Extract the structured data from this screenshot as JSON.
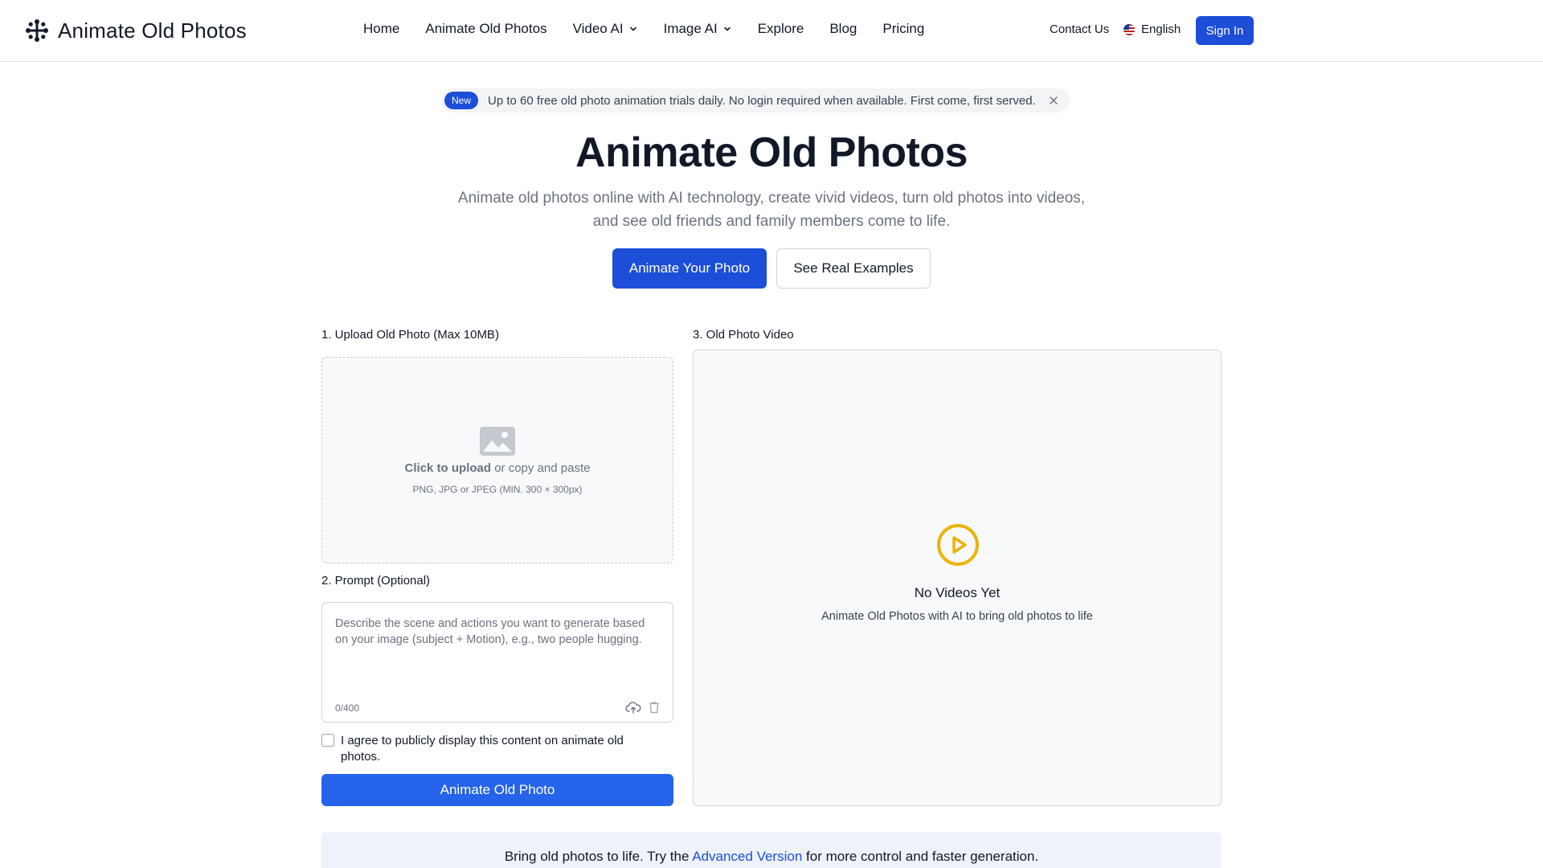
{
  "header": {
    "logo_text": "Animate Old Photos",
    "nav": [
      {
        "label": "Home",
        "dropdown": false
      },
      {
        "label": "Animate Old Photos",
        "dropdown": false
      },
      {
        "label": "Video AI",
        "dropdown": true
      },
      {
        "label": "Image AI",
        "dropdown": true
      },
      {
        "label": "Explore",
        "dropdown": false
      },
      {
        "label": "Blog",
        "dropdown": false
      },
      {
        "label": "Pricing",
        "dropdown": false
      }
    ],
    "contact_label": "Contact Us",
    "language_label": "English",
    "signin_label": "Sign In"
  },
  "announcement": {
    "badge": "New",
    "text": "Up to 60 free old photo animation trials daily. No login required when available. First come, first served."
  },
  "hero": {
    "title": "Animate Old Photos",
    "subtitle": "Animate old photos online with AI technology, create vivid videos, turn old photos into videos, and see old friends and family members come to life.",
    "primary_button": "Animate Your Photo",
    "secondary_button": "See Real Examples"
  },
  "upload": {
    "label": "1. Upload Old Photo (Max 10MB)",
    "click_text": "Click to upload",
    "or_text": " or copy and paste",
    "formats": "PNG, JPG or JPEG (MIN. 300 × 300px)"
  },
  "prompt": {
    "label": "2. Prompt (Optional)",
    "placeholder": "Describe the scene and actions you want to generate based on your image (subject + Motion), e.g., two people hugging.",
    "value": "",
    "counter": "0/400"
  },
  "agreement": {
    "text": "I agree to publicly display this content on animate old photos.",
    "checked": false
  },
  "animate_button": "Animate Old Photo",
  "video": {
    "label": "3. Old Photo Video",
    "empty_title": "No Videos Yet",
    "empty_subtitle": "Animate Old Photos with AI to bring old photos to life"
  },
  "banner": {
    "before": "Bring old photos to life. Try the ",
    "link": "Advanced Version",
    "after": " for more control and faster generation."
  },
  "colors": {
    "primary": "#1d4ed8",
    "animate_button": "#2563eb",
    "play_icon": "#eab308"
  }
}
